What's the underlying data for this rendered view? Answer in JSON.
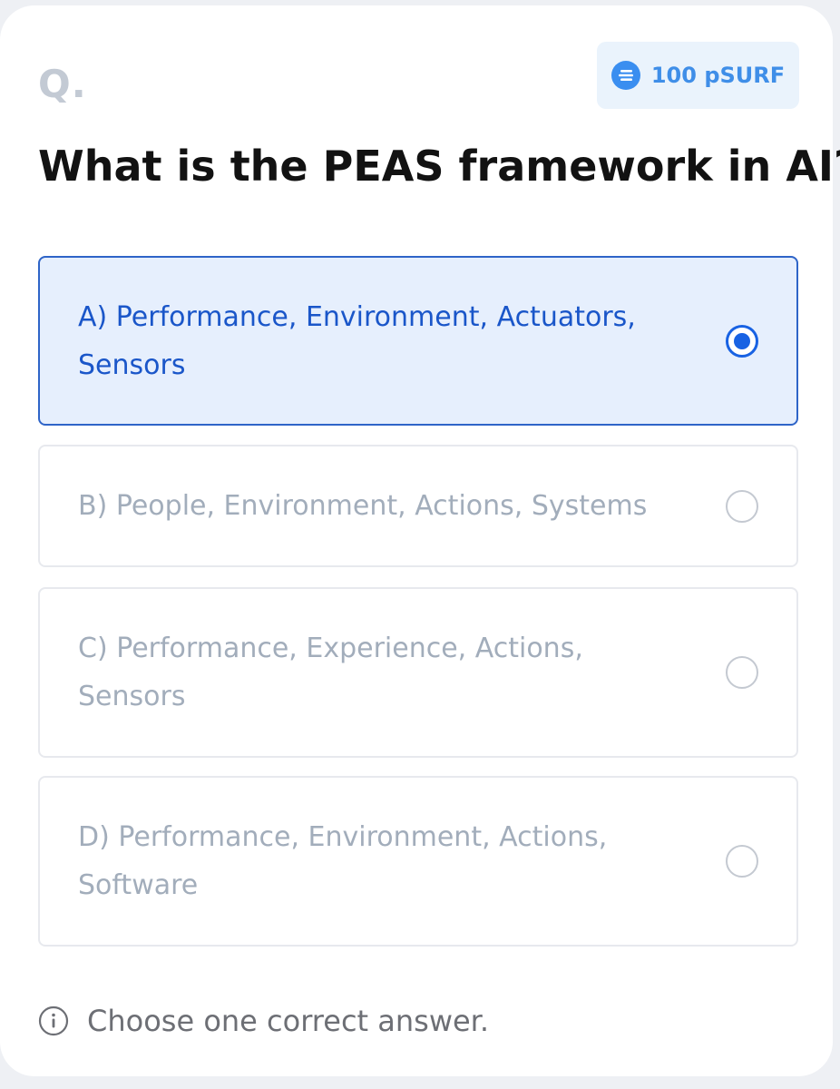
{
  "header": {
    "q_mark": "Q.",
    "reward": {
      "amount_label": "100 pSURF",
      "icon": "token-coin-icon",
      "accent_color": "#3a8ef0"
    }
  },
  "question": {
    "text": "What is the PEAS framework in AI?"
  },
  "options": [
    {
      "label": "A) Performance, Environment, Actuators, Sensors",
      "selected": true
    },
    {
      "label": "B) People, Environment, Actions, Systems",
      "selected": false
    },
    {
      "label": "C) Performance, Experience, Actions, Sensors",
      "selected": false
    },
    {
      "label": "D) Performance, Environment, Actions, Software",
      "selected": false
    }
  ],
  "footer": {
    "hint": "Choose one correct answer.",
    "icon": "info-icon"
  },
  "colors": {
    "selected_border": "#2e64c8",
    "selected_background": "#e6effd",
    "selected_text": "#1a56c9",
    "unselected_text": "#a2adbb"
  }
}
